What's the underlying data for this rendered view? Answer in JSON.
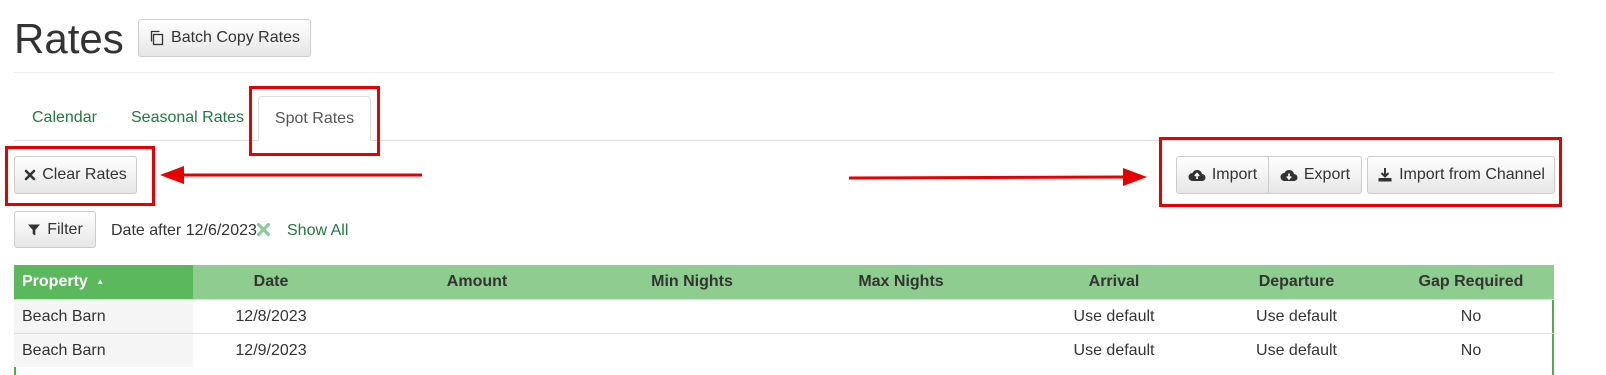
{
  "header": {
    "title": "Rates",
    "batch_copy_label": "Batch Copy Rates"
  },
  "tabs": [
    {
      "label": "Calendar",
      "active": false
    },
    {
      "label": "Seasonal Rates",
      "active": false
    },
    {
      "label": "Spot Rates",
      "active": true
    }
  ],
  "toolbar": {
    "clear_rates_label": "Clear Rates",
    "import_label": "Import",
    "export_label": "Export",
    "import_channel_label": "Import from Channel"
  },
  "filter": {
    "button_label": "Filter",
    "active_filter": "Date after 12/6/2023",
    "show_all_label": "Show All"
  },
  "table": {
    "columns": [
      "Property",
      "Date",
      "Amount",
      "Min Nights",
      "Max Nights",
      "Arrival",
      "Departure",
      "Gap Required"
    ],
    "sort_indicator": "▲",
    "rows": [
      {
        "property": "Beach Barn",
        "date": "12/8/2023",
        "amount": "",
        "min_nights": "",
        "max_nights": "",
        "arrival": "Use default",
        "departure": "Use default",
        "gap_required": "No"
      },
      {
        "property": "Beach Barn",
        "date": "12/9/2023",
        "amount": "",
        "min_nights": "",
        "max_nights": "",
        "arrival": "Use default",
        "departure": "Use default",
        "gap_required": "No"
      }
    ]
  },
  "colors": {
    "accent_green": "#1f7a3f",
    "header_green": "#8fcc8f",
    "sorted_header_green": "#5cb85c",
    "annotation_red": "#e60000"
  }
}
